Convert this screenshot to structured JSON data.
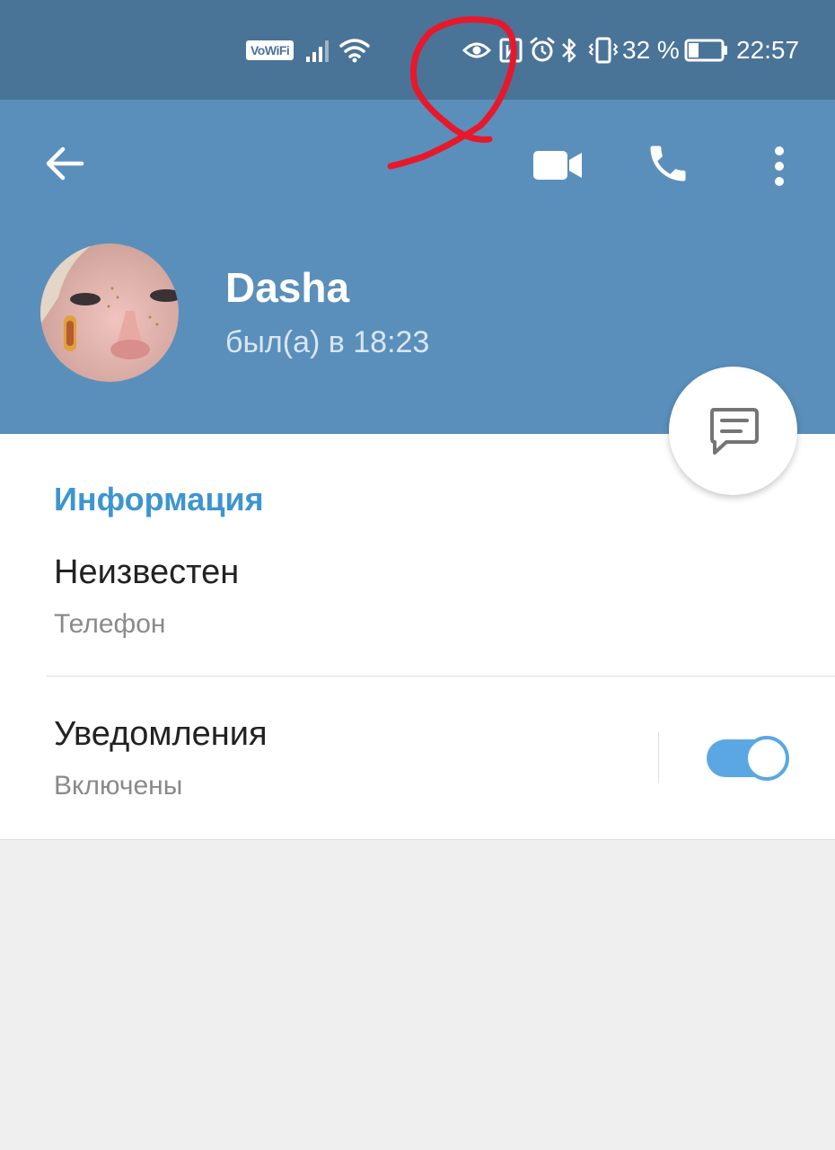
{
  "status_bar": {
    "vowifi": "VoWiFi",
    "battery_percent": "32 %",
    "battery_level": 0.32,
    "time": "22:57",
    "icons": [
      "signal-icon",
      "wifi-icon",
      "eye-icon",
      "nfc-icon",
      "alarm-icon",
      "bluetooth-icon",
      "vibrate-icon",
      "battery-icon"
    ]
  },
  "header": {
    "back_icon": "arrow-left-icon",
    "actions": [
      "video-call-icon",
      "phone-icon",
      "more-vert-icon"
    ]
  },
  "profile": {
    "name": "Dasha",
    "status": "был(а) в 18:23"
  },
  "info": {
    "section_title": "Информация",
    "phone_value": "Неизвестен",
    "phone_label": "Телефон",
    "notifications_title": "Уведомления",
    "notifications_value": "Включены",
    "notifications_on": true
  },
  "fab_icon": "message-icon",
  "colors": {
    "status_bar": "#4a7398",
    "header": "#5a8fbb",
    "accent": "#3d95d0",
    "toggle": "#5ba7e3",
    "annotation": "#e8182b"
  }
}
